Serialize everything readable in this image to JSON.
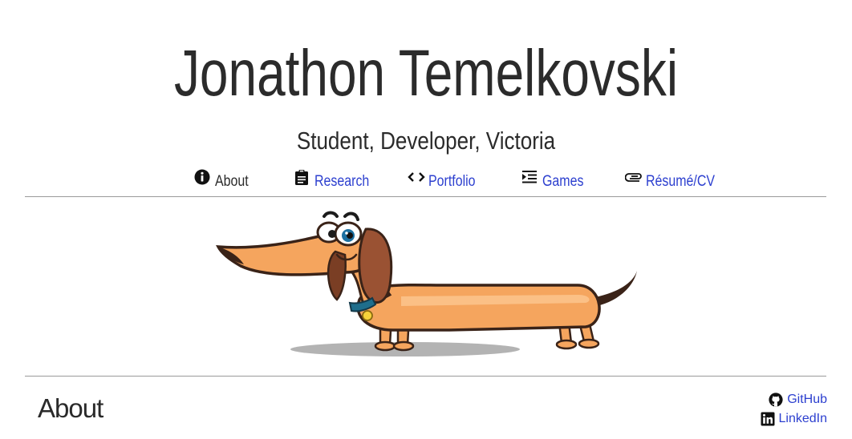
{
  "header": {
    "title": "Jonathon Temelkovski",
    "subtitle": "Student, Developer, Victoria"
  },
  "nav": {
    "items": [
      {
        "label": "About",
        "icon": "info-circle-icon",
        "active": true
      },
      {
        "label": "Research",
        "icon": "clipboard-icon",
        "active": false
      },
      {
        "label": "Portfolio",
        "icon": "code-icon",
        "active": false
      },
      {
        "label": "Games",
        "icon": "indent-list-icon",
        "active": false
      },
      {
        "label": "Résumé/CV",
        "icon": "paperclip-icon",
        "active": false
      }
    ]
  },
  "hero": {
    "image": "dachshund-cartoon"
  },
  "main": {
    "section_title": "About"
  },
  "social": {
    "links": [
      {
        "label": "GitHub",
        "icon": "github-icon"
      },
      {
        "label": "LinkedIn",
        "icon": "linkedin-icon"
      }
    ]
  },
  "colors": {
    "link": "#2c3fcf",
    "text": "#2a2a2a",
    "rule": "#9a9a9a",
    "dog_body": "#f5a55e",
    "dog_ear": "#9a5233",
    "collar": "#1f6e8c"
  }
}
